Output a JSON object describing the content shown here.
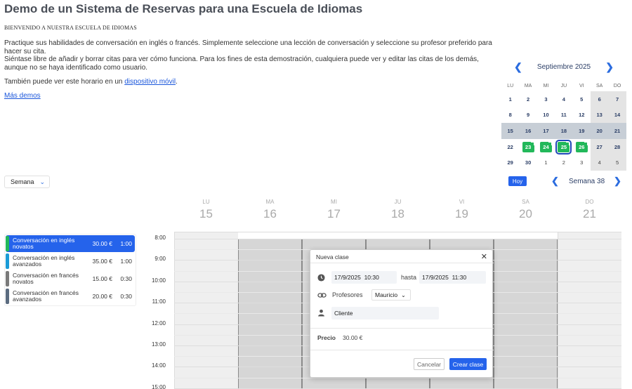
{
  "header": {
    "title": "Demo de un Sistema de Reservas para una Escuela de Idiomas",
    "welcome": "BIENVENIDO A NUESTRA ESCUELA DE IDIOMAS",
    "intro_1": "Practique sus habilidades de conversación en inglés o francés. Simplemente seleccione una lección de conversación y seleccione su profesor preferido para hacer su cita.",
    "intro_2": "Siéntase libre de añadir y borrar citas para ver cómo funciona. Para los fines de esta demostración, cualquiera puede ver y editar las citas de los demás, aunque no se haya identificado como usuario.",
    "mobile_prefix": "También puede ver este horario en un ",
    "mobile_link": "dispositivo móvil",
    "mobile_suffix": ".",
    "more_demos": "Más demos"
  },
  "mini_calendar": {
    "month": "Septiembre 2025",
    "prev_icon": "chevron-left-icon",
    "next_icon": "chevron-right-icon",
    "day_headers": [
      "LU",
      "MA",
      "MI",
      "JU",
      "VI",
      "SA",
      "DO"
    ],
    "weeks": [
      [
        "1",
        "2",
        "3",
        "4",
        "5",
        "6",
        "7"
      ],
      [
        "8",
        "9",
        "10",
        "11",
        "12",
        "13",
        "14"
      ],
      [
        "15",
        "16",
        "17",
        "18",
        "19",
        "20",
        "21"
      ],
      [
        "22",
        "23",
        "24",
        "25",
        "26",
        "27",
        "28"
      ],
      [
        "29",
        "30",
        "1",
        "2",
        "3",
        "4",
        "5"
      ]
    ],
    "booked_days": [
      "23",
      "24",
      "25",
      "26"
    ],
    "selected_day": "25",
    "current_week": 2
  },
  "view_selector": {
    "value": "Semana"
  },
  "week_nav": {
    "today": "Hoy",
    "label": "Semana 38"
  },
  "week_days": [
    {
      "name": "LU",
      "date": "15"
    },
    {
      "name": "MA",
      "date": "16"
    },
    {
      "name": "MI",
      "date": "17"
    },
    {
      "name": "JU",
      "date": "18"
    },
    {
      "name": "VI",
      "date": "19"
    },
    {
      "name": "SA",
      "date": "20"
    },
    {
      "name": "DO",
      "date": "21"
    }
  ],
  "hours": [
    "8:00",
    "9:00",
    "10:00",
    "11:00",
    "12:00",
    "13:00",
    "14:00",
    "15:00"
  ],
  "lessons": [
    {
      "name": "Conversación en inglés novatos",
      "price": "30.00 €",
      "duration": "1:00",
      "color": "#22b85a",
      "active": true
    },
    {
      "name": "Conversación en inglés avanzados",
      "price": "35.00 €",
      "duration": "1:00",
      "color": "#1a9bd7",
      "active": false
    },
    {
      "name": "Conversación en francés novatos",
      "price": "15.00 €",
      "duration": "0:30",
      "color": "#7a7a7a",
      "active": false
    },
    {
      "name": "Conversación en francés avanzados",
      "price": "20.00 €",
      "duration": "0:30",
      "color": "#5b6b7f",
      "active": false
    }
  ],
  "modal": {
    "title": "Nueva clase",
    "start_date": "17/9/2025",
    "start_time": "10:30",
    "until": "hasta",
    "end_date": "17/9/2025",
    "end_time": "11:30",
    "teachers_label": "Profesores",
    "teacher_value": "Mauricio",
    "client_placeholder": "Cliente",
    "price_label": "Precio",
    "price_value": "30.00 €",
    "cancel": "Cancelar",
    "create": "Crear clase"
  },
  "colors": {
    "accent": "#2563eb",
    "booked": "#22b85a"
  }
}
